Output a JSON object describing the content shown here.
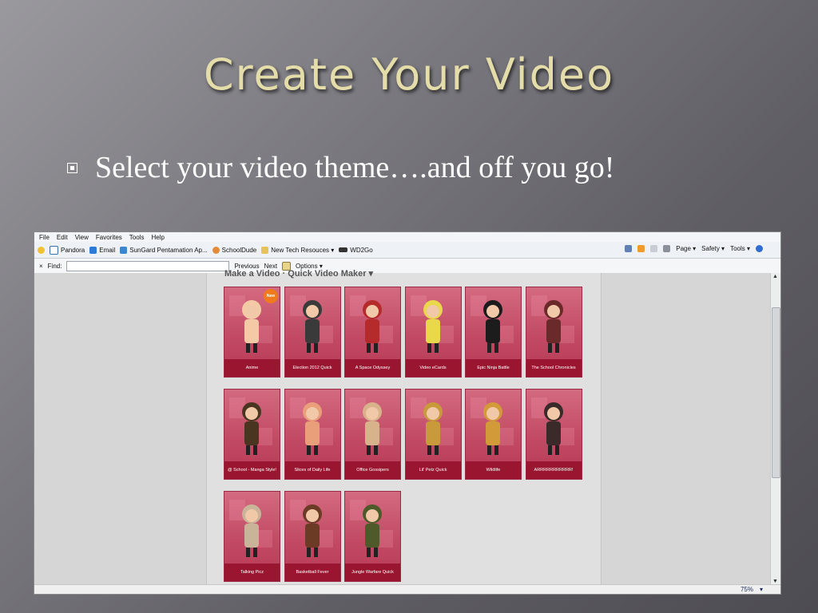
{
  "slide": {
    "title": "Create Your Video",
    "bullet": "Select your video theme….and off you go!"
  },
  "browser": {
    "menu": [
      "File",
      "Edit",
      "View",
      "Favorites",
      "Tools",
      "Help"
    ],
    "favorites": [
      "Pandora",
      "Email",
      "SunGard Pentamation Ap...",
      "SchoolDude",
      "New Tech Resouces ▾",
      "WD2Go"
    ],
    "commands": [
      "Page ▾",
      "Safety ▾",
      "Tools ▾"
    ],
    "find": {
      "close": "×",
      "label": "Find:",
      "value": "",
      "previous": "Previous",
      "next": "Next",
      "options": "Options ▾"
    },
    "heading": "Make a Video  ·  Quick Video Maker ▾",
    "themes": [
      {
        "label": "Anime",
        "badge": "New"
      },
      {
        "label": "Election 2012 Quick"
      },
      {
        "label": "A Space Odyssey"
      },
      {
        "label": "Video eCards"
      },
      {
        "label": "Epic Ninja Battle"
      },
      {
        "label": "The School Chronicles"
      },
      {
        "label": "@ School - Manga Style!"
      },
      {
        "label": "Slices of Daily Life"
      },
      {
        "label": "Office Gossipers"
      },
      {
        "label": "Lil' Petz Quick"
      },
      {
        "label": "Wildlife"
      },
      {
        "label": "ARRRRRRRRRRR!"
      },
      {
        "label": "Talking Picz"
      },
      {
        "label": "Basketball Fever"
      },
      {
        "label": "Jungle Warfare Quick"
      }
    ],
    "zoom": "75%"
  }
}
